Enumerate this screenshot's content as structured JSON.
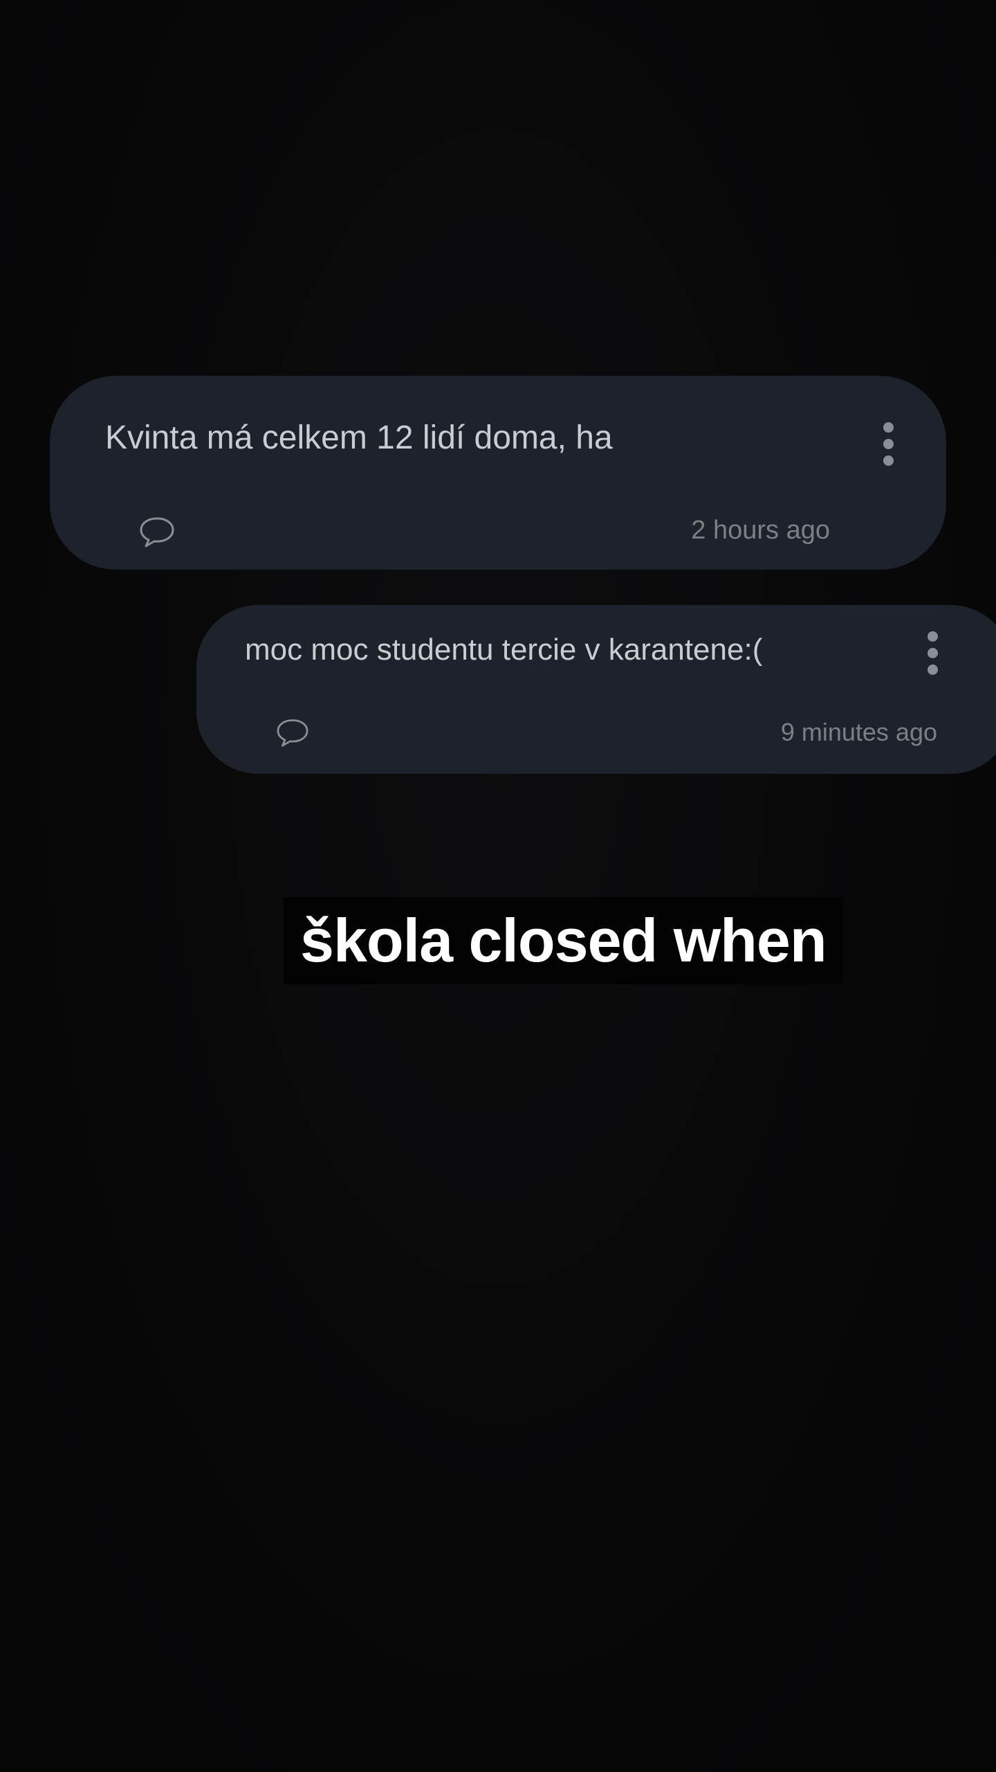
{
  "posts": [
    {
      "text": "Kvinta má celkem 12 lidí doma, ha",
      "time": "2 hours ago",
      "comment_icon": "speech-bubble-icon",
      "menu_icon": "more-vertical-icon"
    },
    {
      "text": "moc moc studentu tercie v karantene:(",
      "time": "9 minutes ago",
      "comment_icon": "speech-bubble-icon",
      "menu_icon": "more-vertical-icon"
    }
  ],
  "caption": {
    "text": "škola closed when"
  },
  "colors": {
    "background": "#070708",
    "card": "#1e232b",
    "message_text": "#c9cdd3",
    "timestamp": "#7b8087",
    "icon": "#8a8f96",
    "caption_bg": "#030303",
    "caption_text": "#ffffff"
  }
}
